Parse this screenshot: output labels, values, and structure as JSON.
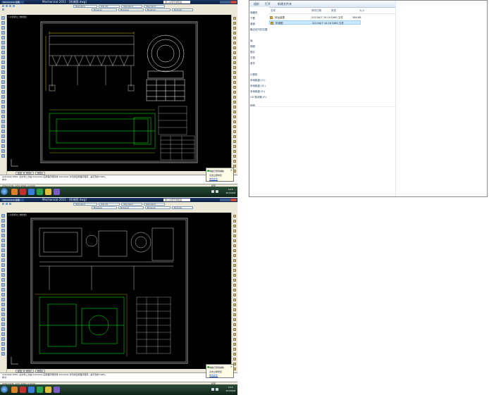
{
  "cad_window": {
    "app_menu": "Mechanical 经典",
    "title": "Mechanical 2011 - [机械图.dwg]",
    "search_value": "键入关键字或短语",
    "toolbar_combos": [
      "Standard",
      "ISO-25",
      "Standard",
      "Standard",
      "ByLayer",
      "ByLayer",
      "ByLayer",
      "ByColor"
    ],
    "view_label": "[-][俯视][二维线框]",
    "tabs": [
      "模型",
      "布局1",
      "布局2"
    ],
    "command_lines": [
      "Autodesk DWG. 此文件上次由 Autodesk 应用程序保存或 Autodesk 许可的应用程序保存，是可靠的 DWG。",
      "命令:"
    ],
    "status_coords": "2560.4378, 1257.6390, 0.0000",
    "status_right": "模型",
    "notification": {
      "title": "电脑已受到威胁",
      "message": "点击立即修复",
      "link": "单击此处"
    },
    "clock": {
      "time": "9:15",
      "date": "2013/6/8"
    }
  },
  "explorer": {
    "organize": "组织",
    "open": "打开",
    "new_folder": "新建文件夹",
    "sidebar": [
      "收藏夹",
      "下载",
      "桌面",
      "最近访问的位置",
      "库",
      "视频",
      "图片",
      "文档",
      "音乐",
      "计算机",
      "本地磁盘 (C:)",
      "本地磁盘 (D:)",
      "本地磁盘 (E:)",
      "CD 驱动器 (F:)",
      "网络"
    ],
    "columns": [
      "名称",
      "修改日期",
      "类型",
      "大小"
    ],
    "files": [
      {
        "name": "转运装置",
        "date": "2013/6/7 10:19",
        "type": "DWG 文件",
        "size": "366 KB",
        "selected": false
      },
      {
        "name": "机械图",
        "date": "2013/6/7 10:18",
        "type": "DWG 文件",
        "size": "",
        "selected": true
      }
    ]
  },
  "colors": {
    "cad_bg": "#000000",
    "titlebar": "#1a3a6a",
    "taskbar": "#1b3a2a",
    "selection": "#cce8ff"
  }
}
